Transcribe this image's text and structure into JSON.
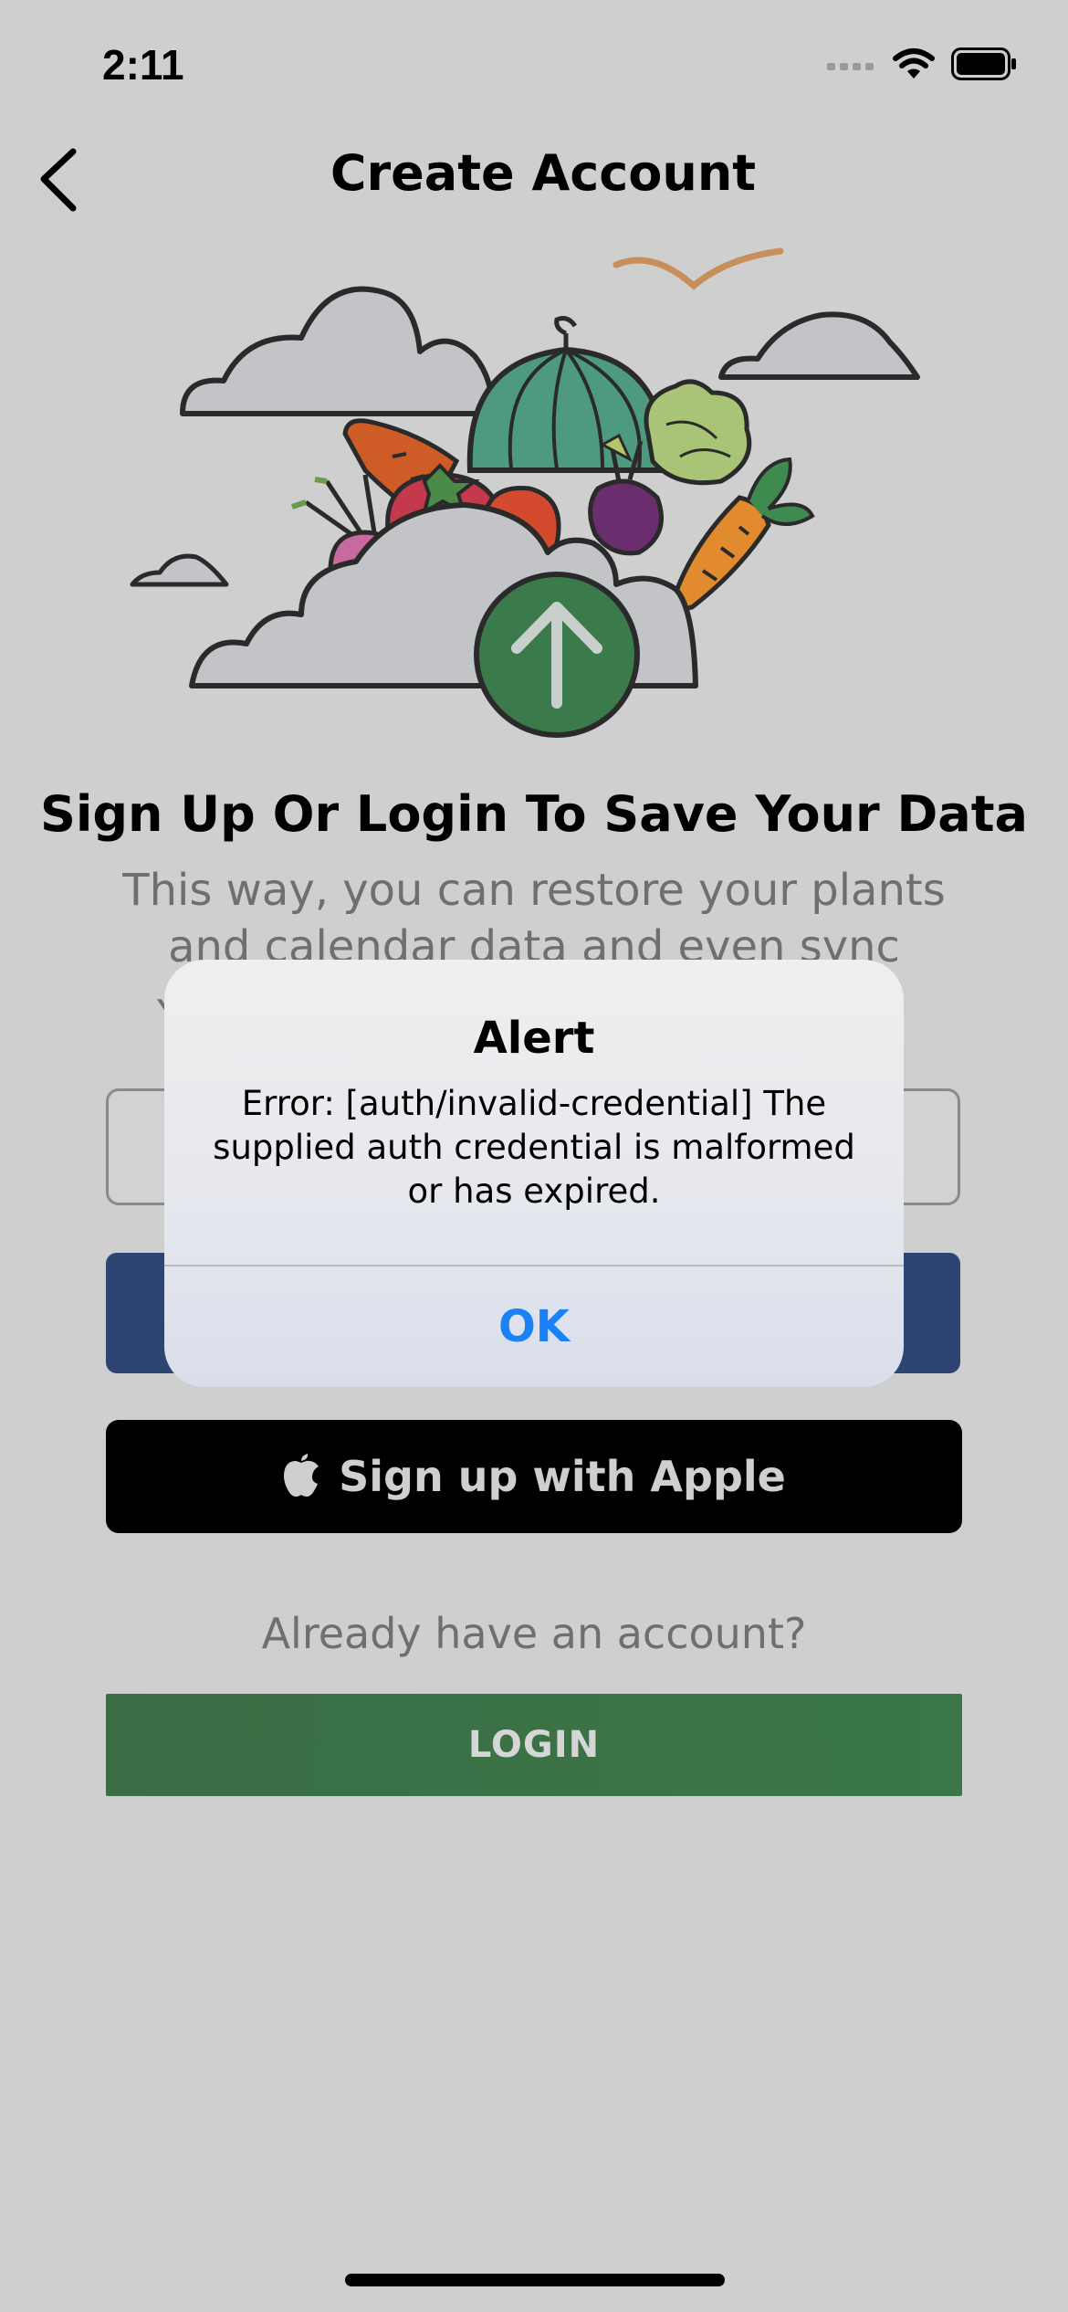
{
  "status_bar": {
    "time": "2:11"
  },
  "header": {
    "title": "Create Account"
  },
  "content": {
    "headline": "Sign Up Or Login To Save Your Data",
    "subline": "This way, you can restore your plants and calendar data and even sync",
    "partial_line": "Y"
  },
  "buttons": {
    "apple_label": "Sign up with Apple",
    "already_text": "Already have an account?",
    "login_label": "LOGIN"
  },
  "alert": {
    "title": "Alert",
    "message": "Error: [auth/invalid-credential] The supplied auth credential is malformed or has expired.",
    "ok_label": "OK"
  },
  "colors": {
    "background": "#cfcfcf",
    "login_green": "#3b7748",
    "facebook_blue": "#2e4473",
    "alert_ok_blue": "#1a82f6"
  }
}
